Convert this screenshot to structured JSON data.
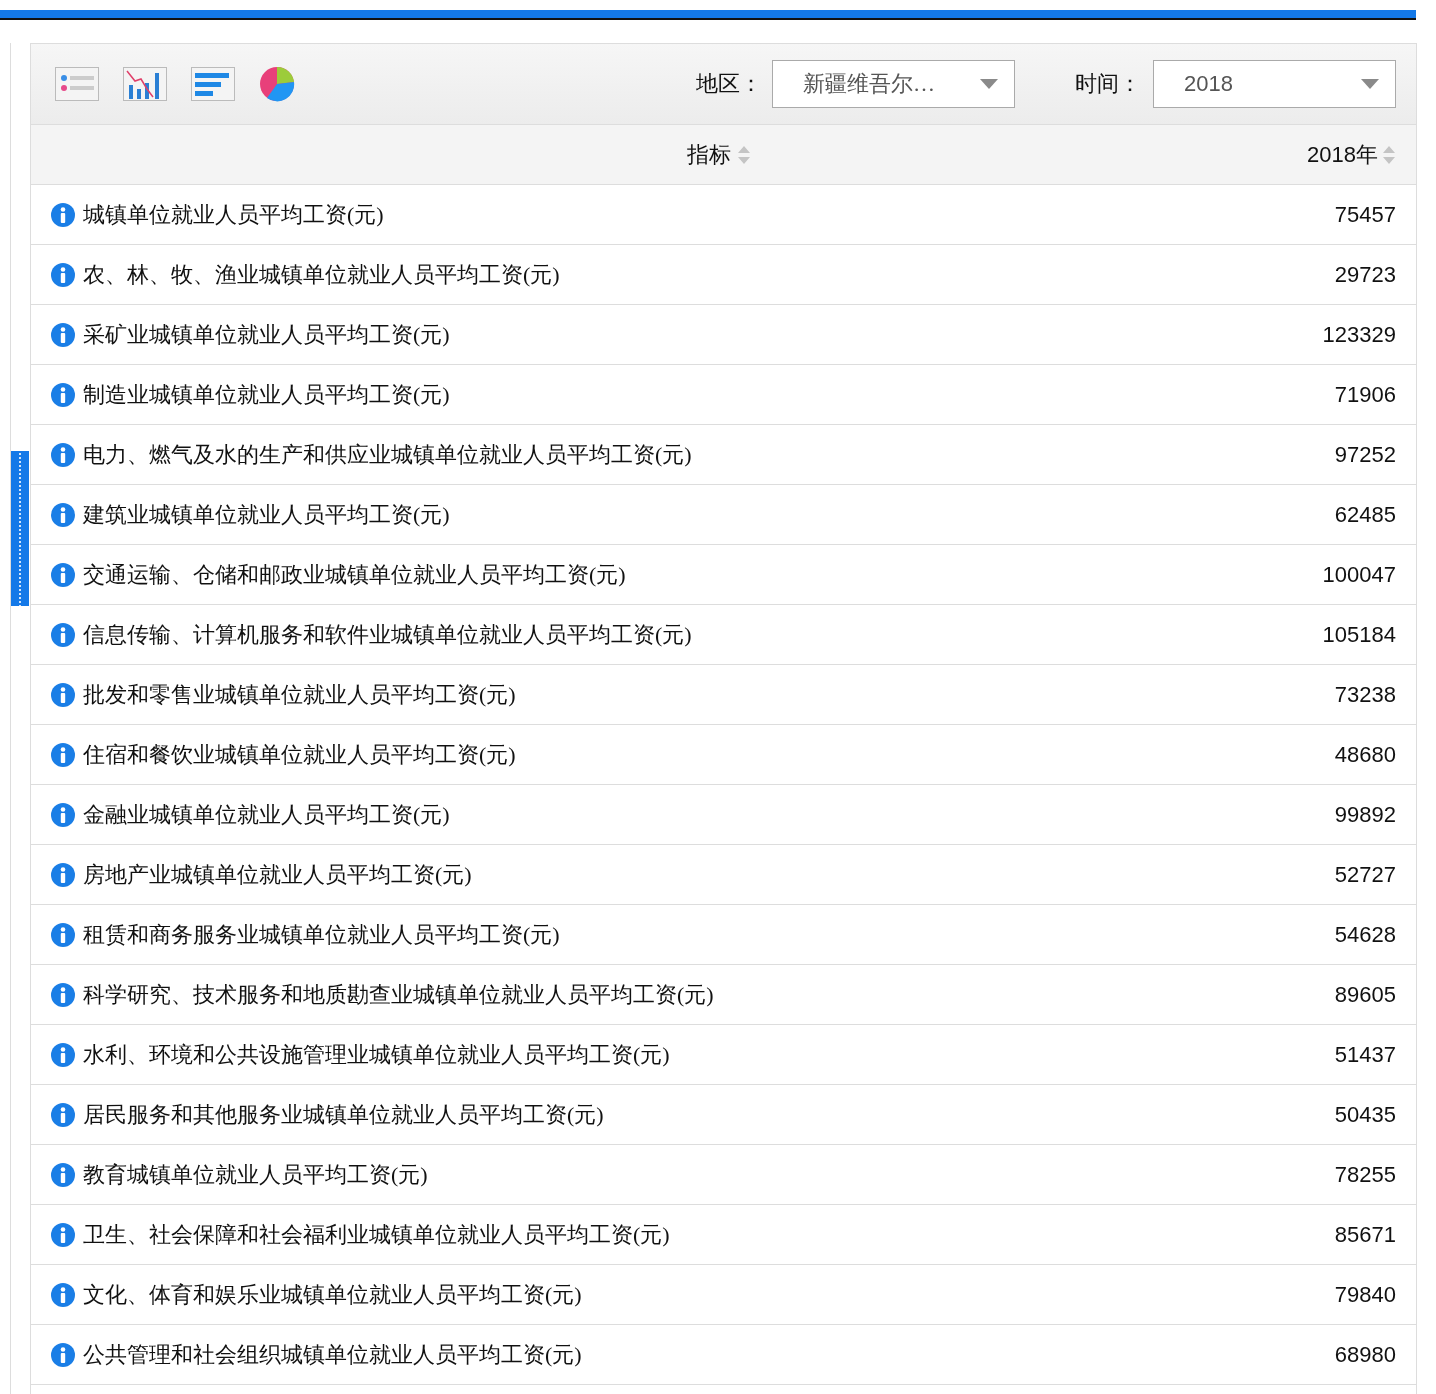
{
  "toolbar": {
    "region": {
      "label": "地区：",
      "value": "新疆维吾尔…"
    },
    "time": {
      "label": "时间：",
      "value": "2018"
    }
  },
  "table": {
    "columns": [
      "指标",
      "2018年"
    ],
    "rows": [
      {
        "indicator": "城镇单位就业人员平均工资(元)",
        "value": "75457"
      },
      {
        "indicator": "农、林、牧、渔业城镇单位就业人员平均工资(元)",
        "value": "29723"
      },
      {
        "indicator": "采矿业城镇单位就业人员平均工资(元)",
        "value": "123329"
      },
      {
        "indicator": "制造业城镇单位就业人员平均工资(元)",
        "value": "71906"
      },
      {
        "indicator": "电力、燃气及水的生产和供应业城镇单位就业人员平均工资(元)",
        "value": "97252"
      },
      {
        "indicator": "建筑业城镇单位就业人员平均工资(元)",
        "value": "62485"
      },
      {
        "indicator": "交通运输、仓储和邮政业城镇单位就业人员平均工资(元)",
        "value": "100047"
      },
      {
        "indicator": "信息传输、计算机服务和软件业城镇单位就业人员平均工资(元)",
        "value": "105184"
      },
      {
        "indicator": "批发和零售业城镇单位就业人员平均工资(元)",
        "value": "73238"
      },
      {
        "indicator": "住宿和餐饮业城镇单位就业人员平均工资(元)",
        "value": "48680"
      },
      {
        "indicator": "金融业城镇单位就业人员平均工资(元)",
        "value": "99892"
      },
      {
        "indicator": "房地产业城镇单位就业人员平均工资(元)",
        "value": "52727"
      },
      {
        "indicator": "租赁和商务服务业城镇单位就业人员平均工资(元)",
        "value": "54628"
      },
      {
        "indicator": "科学研究、技术服务和地质勘查业城镇单位就业人员平均工资(元)",
        "value": "89605"
      },
      {
        "indicator": "水利、环境和公共设施管理业城镇单位就业人员平均工资(元)",
        "value": "51437"
      },
      {
        "indicator": "居民服务和其他服务业城镇单位就业人员平均工资(元)",
        "value": "50435"
      },
      {
        "indicator": "教育城镇单位就业人员平均工资(元)",
        "value": "78255"
      },
      {
        "indicator": "卫生、社会保障和社会福利业城镇单位就业人员平均工资(元)",
        "value": "85671"
      },
      {
        "indicator": "文化、体育和娱乐业城镇单位就业人员平均工资(元)",
        "value": "79840"
      },
      {
        "indicator": "公共管理和社会组织城镇单位就业人员平均工资(元)",
        "value": "68980"
      }
    ]
  }
}
